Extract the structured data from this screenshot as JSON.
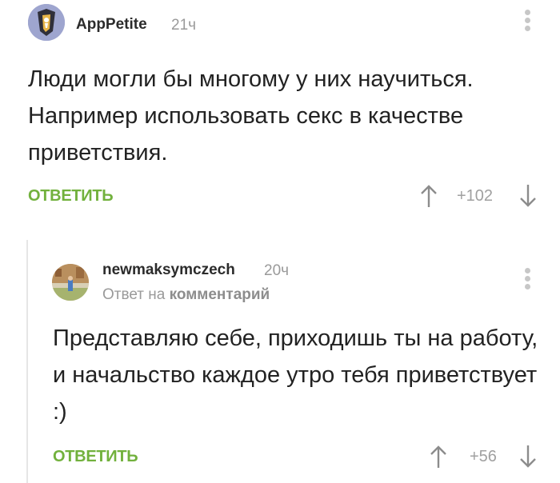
{
  "comments": [
    {
      "author": "AppPetite",
      "time": "21ч",
      "text": "Люди могли бы многому у них научиться. Например использовать секс в качестве приветствия.",
      "reply_label": "ОТВЕТИТЬ",
      "score": "+102"
    },
    {
      "author": "newmaksymczech",
      "time": "20ч",
      "reply_to_prefix": "Ответ на",
      "reply_to_target": "комментарий",
      "text": "Представляю себе, приходишь ты на работу, и начальство каждое утро тебя приветствует :)",
      "reply_label": "ОТВЕТИТЬ",
      "score": "+56"
    }
  ],
  "colors": {
    "accent_green": "#72b13d",
    "muted_gray": "#9a9a9a",
    "text_dark": "#222222"
  },
  "icons": [
    "avatar",
    "more-vertical-icon",
    "arrow-up-icon",
    "arrow-down-icon"
  ]
}
